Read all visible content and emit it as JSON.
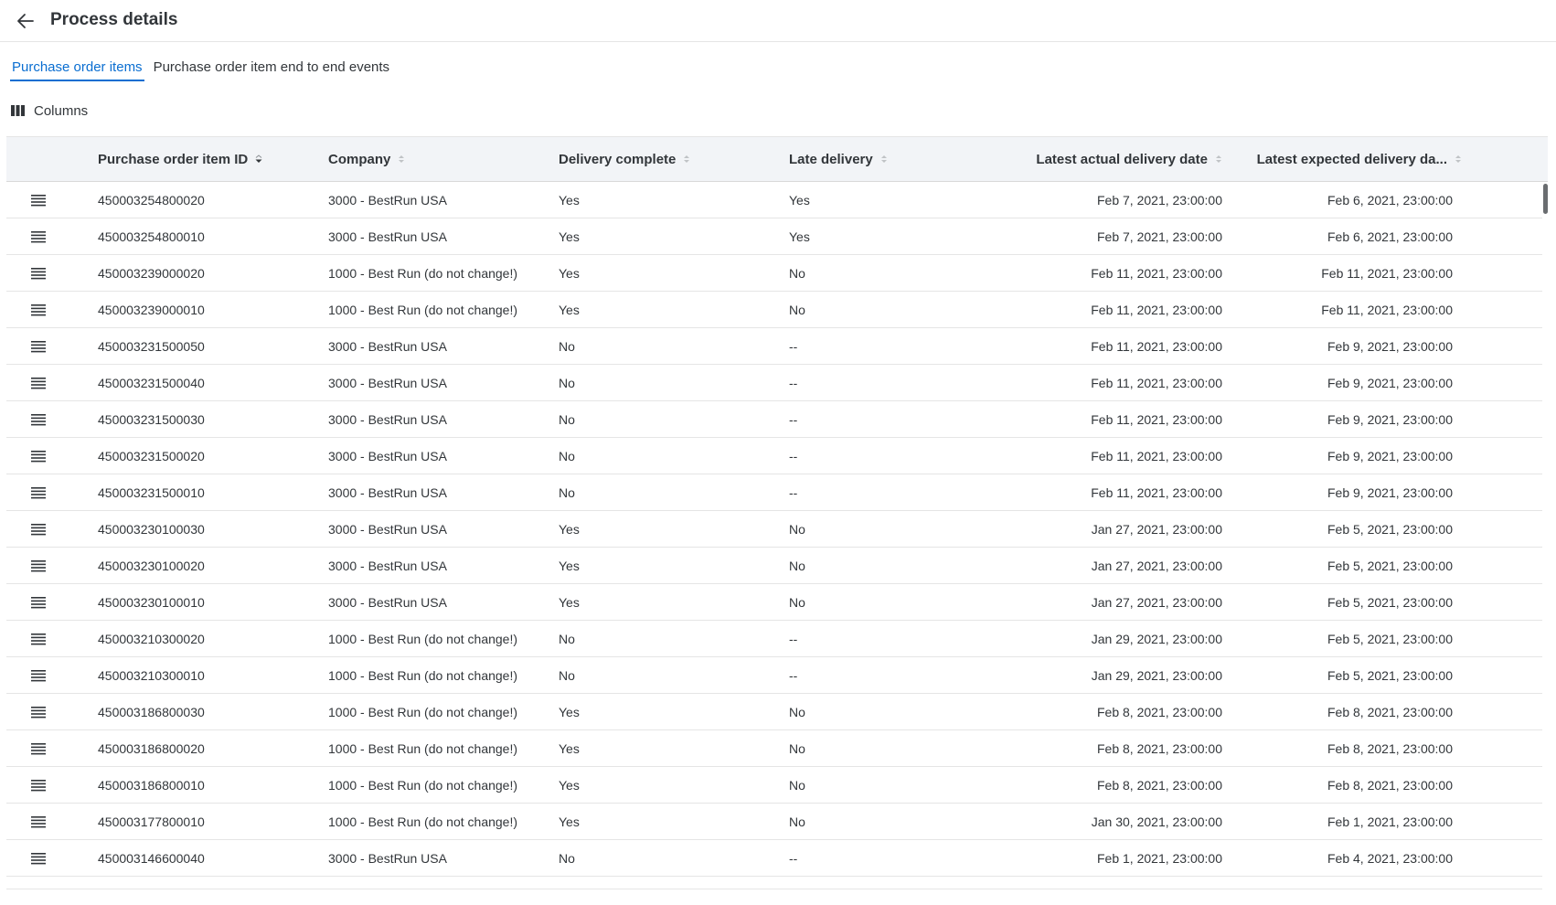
{
  "header": {
    "title": "Process details"
  },
  "tabs": [
    {
      "label": "Purchase order items",
      "active": true
    },
    {
      "label": "Purchase order item end to end events",
      "active": false
    }
  ],
  "toolbar": {
    "columns_label": "Columns"
  },
  "table": {
    "columns": [
      "Purchase order item ID",
      "Company",
      "Delivery complete",
      "Late delivery",
      "Latest actual delivery date",
      "Latest expected delivery da..."
    ],
    "rows": [
      {
        "id": "450003254800020",
        "company": "3000 - BestRun USA",
        "delivery": "Yes",
        "late": "Yes",
        "actual": "Feb 7, 2021, 23:00:00",
        "expected": "Feb 6, 2021, 23:00:00"
      },
      {
        "id": "450003254800010",
        "company": "3000 - BestRun USA",
        "delivery": "Yes",
        "late": "Yes",
        "actual": "Feb 7, 2021, 23:00:00",
        "expected": "Feb 6, 2021, 23:00:00"
      },
      {
        "id": "450003239000020",
        "company": "1000 - Best Run (do not change!)",
        "delivery": "Yes",
        "late": "No",
        "actual": "Feb 11, 2021, 23:00:00",
        "expected": "Feb 11, 2021, 23:00:00"
      },
      {
        "id": "450003239000010",
        "company": "1000 - Best Run (do not change!)",
        "delivery": "Yes",
        "late": "No",
        "actual": "Feb 11, 2021, 23:00:00",
        "expected": "Feb 11, 2021, 23:00:00"
      },
      {
        "id": "450003231500050",
        "company": "3000 - BestRun USA",
        "delivery": "No",
        "late": "--",
        "actual": "Feb 11, 2021, 23:00:00",
        "expected": "Feb 9, 2021, 23:00:00"
      },
      {
        "id": "450003231500040",
        "company": "3000 - BestRun USA",
        "delivery": "No",
        "late": "--",
        "actual": "Feb 11, 2021, 23:00:00",
        "expected": "Feb 9, 2021, 23:00:00"
      },
      {
        "id": "450003231500030",
        "company": "3000 - BestRun USA",
        "delivery": "No",
        "late": "--",
        "actual": "Feb 11, 2021, 23:00:00",
        "expected": "Feb 9, 2021, 23:00:00"
      },
      {
        "id": "450003231500020",
        "company": "3000 - BestRun USA",
        "delivery": "No",
        "late": "--",
        "actual": "Feb 11, 2021, 23:00:00",
        "expected": "Feb 9, 2021, 23:00:00"
      },
      {
        "id": "450003231500010",
        "company": "3000 - BestRun USA",
        "delivery": "No",
        "late": "--",
        "actual": "Feb 11, 2021, 23:00:00",
        "expected": "Feb 9, 2021, 23:00:00"
      },
      {
        "id": "450003230100030",
        "company": "3000 - BestRun USA",
        "delivery": "Yes",
        "late": "No",
        "actual": "Jan 27, 2021, 23:00:00",
        "expected": "Feb 5, 2021, 23:00:00"
      },
      {
        "id": "450003230100020",
        "company": "3000 - BestRun USA",
        "delivery": "Yes",
        "late": "No",
        "actual": "Jan 27, 2021, 23:00:00",
        "expected": "Feb 5, 2021, 23:00:00"
      },
      {
        "id": "450003230100010",
        "company": "3000 - BestRun USA",
        "delivery": "Yes",
        "late": "No",
        "actual": "Jan 27, 2021, 23:00:00",
        "expected": "Feb 5, 2021, 23:00:00"
      },
      {
        "id": "450003210300020",
        "company": "1000 - Best Run (do not change!)",
        "delivery": "No",
        "late": "--",
        "actual": "Jan 29, 2021, 23:00:00",
        "expected": "Feb 5, 2021, 23:00:00"
      },
      {
        "id": "450003210300010",
        "company": "1000 - Best Run (do not change!)",
        "delivery": "No",
        "late": "--",
        "actual": "Jan 29, 2021, 23:00:00",
        "expected": "Feb 5, 2021, 23:00:00"
      },
      {
        "id": "450003186800030",
        "company": "1000 - Best Run (do not change!)",
        "delivery": "Yes",
        "late": "No",
        "actual": "Feb 8, 2021, 23:00:00",
        "expected": "Feb 8, 2021, 23:00:00"
      },
      {
        "id": "450003186800020",
        "company": "1000 - Best Run (do not change!)",
        "delivery": "Yes",
        "late": "No",
        "actual": "Feb 8, 2021, 23:00:00",
        "expected": "Feb 8, 2021, 23:00:00"
      },
      {
        "id": "450003186800010",
        "company": "1000 - Best Run (do not change!)",
        "delivery": "Yes",
        "late": "No",
        "actual": "Feb 8, 2021, 23:00:00",
        "expected": "Feb 8, 2021, 23:00:00"
      },
      {
        "id": "450003177800010",
        "company": "1000 - Best Run (do not change!)",
        "delivery": "Yes",
        "late": "No",
        "actual": "Jan 30, 2021, 23:00:00",
        "expected": "Feb 1, 2021, 23:00:00"
      },
      {
        "id": "450003146600040",
        "company": "3000 - BestRun USA",
        "delivery": "No",
        "late": "--",
        "actual": "Feb 1, 2021, 23:00:00",
        "expected": "Feb 4, 2021, 23:00:00"
      }
    ]
  },
  "icons": {
    "back": "arrow-left-icon",
    "columns": "columns-icon",
    "row_menu": "list-lines-icon",
    "sort": "sort-icon"
  },
  "colors": {
    "accent": "#0a6ed1",
    "header_bg": "#f2f4f7",
    "text": "#32363a"
  }
}
